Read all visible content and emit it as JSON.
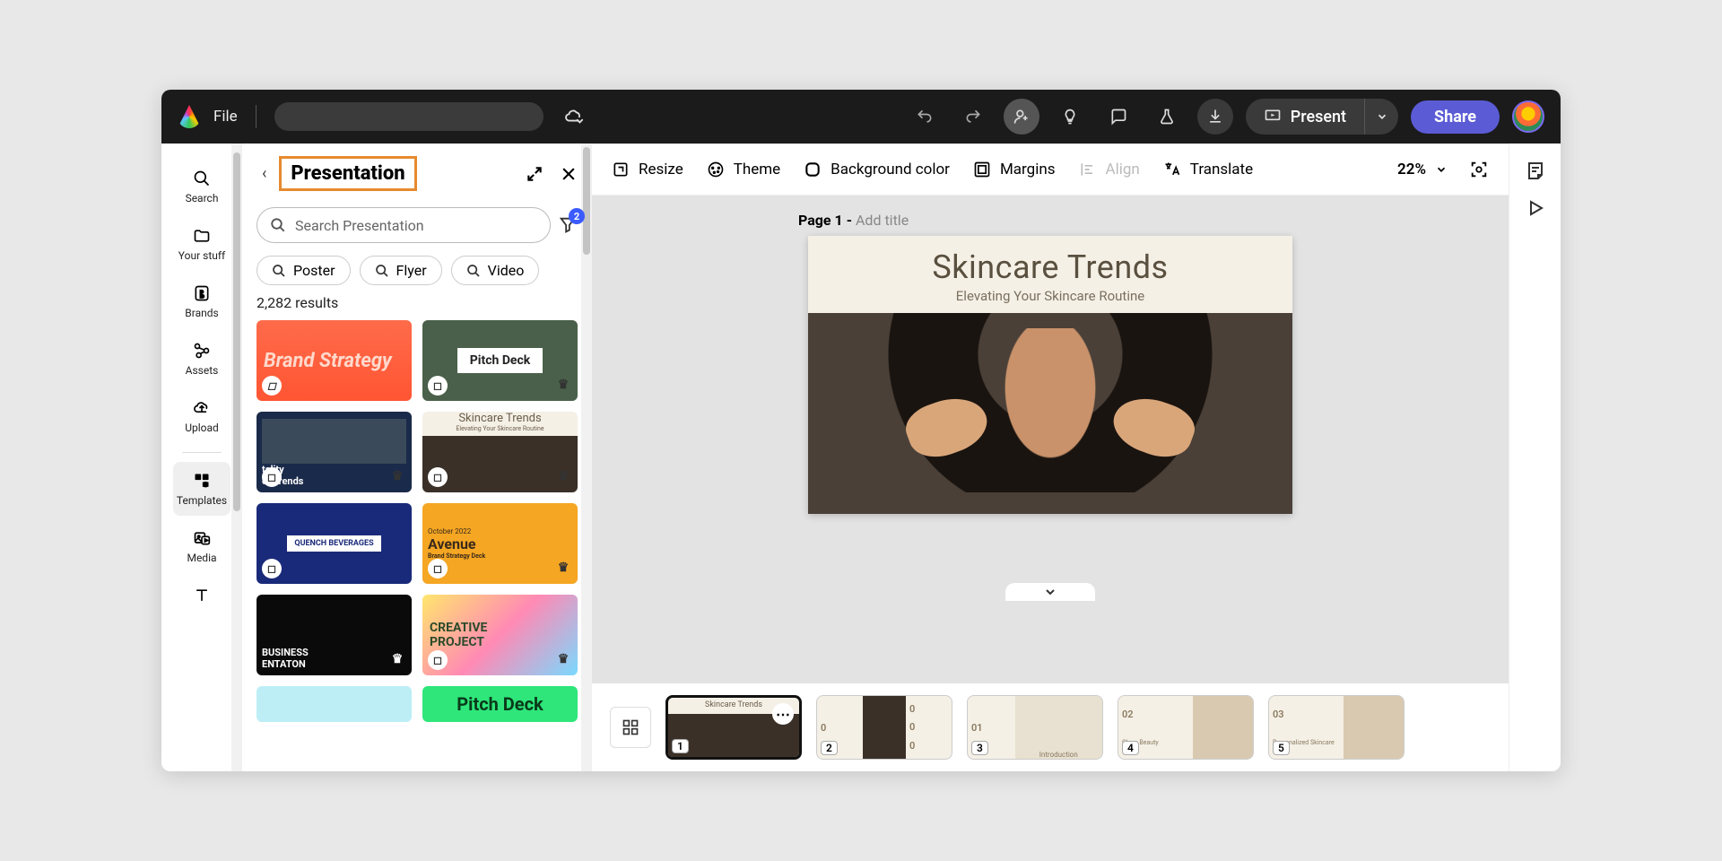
{
  "topbar": {
    "file_label": "File",
    "present_label": "Present",
    "share_label": "Share"
  },
  "rail": {
    "search": "Search",
    "your_stuff": "Your stuff",
    "brands": "Brands",
    "assets": "Assets",
    "upload": "Upload",
    "templates": "Templates",
    "media": "Media"
  },
  "panel": {
    "title": "Presentation",
    "search_placeholder": "Search Presentation",
    "filter_badge": "2",
    "chips": {
      "poster": "Poster",
      "flyer": "Flyer",
      "video": "Video"
    },
    "results": "2,282 results",
    "cards": {
      "c1": "Brand Strategy",
      "c2": "Pitch Deck",
      "c3_a": "tality",
      "c3_b": "et Trends",
      "c4_a": "Skincare Trends",
      "c4_b": "Elevating Your Skincare Routine",
      "c5": "QUENCH BEVERAGES",
      "c6_a": "October 2022",
      "c6_b": "Avenue",
      "c6_c": "Brand Strategy Deck",
      "c7_a": "BUSINESS",
      "c7_b": "ENTATON",
      "c8_a": "CREATIVE",
      "c8_b": "PROJECT",
      "c10": "Pitch Deck"
    }
  },
  "toolbar": {
    "resize": "Resize",
    "theme": "Theme",
    "bgcolor": "Background color",
    "margins": "Margins",
    "align": "Align",
    "translate": "Translate",
    "zoom": "22%"
  },
  "stage": {
    "page_label_a": "Page 1 - ",
    "page_label_b": "Add title",
    "slide_title": "Skincare Trends",
    "slide_sub": "Elevating Your Skincare Routine"
  },
  "thumbs": {
    "n1": "1",
    "n2": "2",
    "n3": "3",
    "n4": "4",
    "n5": "5",
    "t1": "Skincare Trends",
    "t3n": "01",
    "t4n": "02",
    "t5n": "03",
    "t5": "Personalized Skincare",
    "t3b": "Introduction",
    "t4b": "Clean Beauty"
  }
}
